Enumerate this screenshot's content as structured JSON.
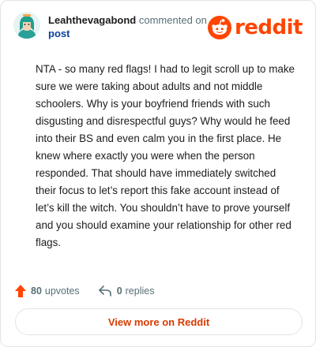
{
  "header": {
    "username": "Leahthevagabond",
    "action_text": "commented on",
    "post_link": "post",
    "logo_text": "reddit"
  },
  "comment": {
    "text": "NTA - so many red flags! I had to legit scroll up to make sure we were taking about adults and not middle schoolers. Why is your boyfriend friends with such disgusting and disrespectful guys? Why would he feed into their BS and even calm you in the first place. He knew where exactly you were when the person responded. That should have immediately switched their focus to let’s report this fake account instead of let’s kill the witch. You shouldn’t have to prove yourself and you should examine your relationship for other red flags."
  },
  "footer": {
    "upvotes_count": "80",
    "upvotes_label": "upvotes",
    "replies_count": "0",
    "replies_label": "replies",
    "view_more_label": "View more on Reddit"
  },
  "colors": {
    "brand": "#ff4500",
    "link": "#0a449b",
    "button_text": "#d93a00",
    "muted": "#576f76"
  },
  "icons": [
    "avatar",
    "reddit-snoo-icon",
    "upvote-arrow-icon",
    "reply-icon"
  ]
}
